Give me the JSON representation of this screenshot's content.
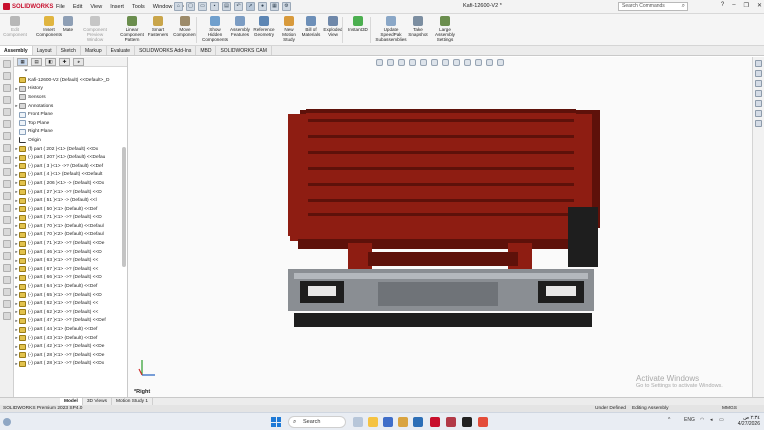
{
  "app": {
    "brand": "SOLIDWORKS",
    "document_title": "Kafi-12600-V2 *"
  },
  "menus": [
    "File",
    "Edit",
    "View",
    "Insert",
    "Tools",
    "Window"
  ],
  "search": {
    "placeholder": "Search Commands"
  },
  "ribbon": [
    {
      "label": "Edit Component",
      "enabled": false,
      "color": "#b7b7b7"
    },
    {
      "label": "Insert Components",
      "enabled": true,
      "color": "#e0b540"
    },
    {
      "label": "Mate",
      "enabled": true,
      "color": "#8e9fb5"
    },
    {
      "label": "Component Preview Window",
      "enabled": false,
      "color": "#c6c6c6"
    },
    {
      "label": "Linear Component Pattern",
      "enabled": true,
      "color": "#6b8e4e"
    },
    {
      "label": "Smart Fasteners",
      "enabled": true,
      "color": "#c9a54a"
    },
    {
      "label": "Move Component",
      "enabled": true,
      "color": "#9d8b6a"
    },
    {
      "label": "Show Hidden Components",
      "enabled": true,
      "color": "#6f9fcd"
    },
    {
      "label": "Assembly Features",
      "enabled": true,
      "color": "#7b9cc3"
    },
    {
      "label": "Reference Geometry",
      "enabled": true,
      "color": "#5d86b4"
    },
    {
      "label": "New Motion Study",
      "enabled": true,
      "color": "#d89a3c"
    },
    {
      "label": "Bill of Materials",
      "enabled": true,
      "color": "#6d8fb8"
    },
    {
      "label": "Exploded View",
      "enabled": true,
      "color": "#6f88aa"
    },
    {
      "label": "Instant3D",
      "enabled": true,
      "color": "#4caf50"
    },
    {
      "label": "Update SpeedPak Subassemblies",
      "enabled": true,
      "color": "#8aa7c7"
    },
    {
      "label": "Take Snapshot",
      "enabled": true,
      "color": "#7c8ea1"
    },
    {
      "label": "Large Assembly Settings",
      "enabled": true,
      "color": "#6b8e4e"
    }
  ],
  "tabs": [
    "Assembly",
    "Layout",
    "Sketch",
    "Markup",
    "Evaluate",
    "SOLIDWORKS Add-Ins",
    "MBD",
    "SOLIDWORKS CAM"
  ],
  "active_tab": "Assembly",
  "tree": {
    "root": "Kafi-12600-V2 (Default) <<Default>_D",
    "items": [
      {
        "label": "History",
        "icon": "folder",
        "expandable": true
      },
      {
        "label": "Sensors",
        "icon": "folder",
        "expandable": false
      },
      {
        "label": "Annotations",
        "icon": "folder",
        "expandable": true
      },
      {
        "label": "Front Plane",
        "icon": "plane",
        "expandable": false
      },
      {
        "label": "Top Plane",
        "icon": "plane",
        "expandable": false
      },
      {
        "label": "Right Plane",
        "icon": "plane",
        "expandable": false
      },
      {
        "label": "Origin",
        "icon": "origin",
        "expandable": false
      },
      {
        "label": "(f) part ( 202 )<1> (Default) <<Dx",
        "icon": "part",
        "expandable": true
      },
      {
        "label": "(-) part ( 207 )<1> (Default) <<Defau",
        "icon": "part",
        "expandable": true
      },
      {
        "label": "(-) part ( 3 )<1> ->? (Default) <<Def",
        "icon": "part",
        "expandable": true
      },
      {
        "label": "(-) part ( 4 )<1> (Default) <<Default",
        "icon": "part",
        "expandable": true
      },
      {
        "label": "(-) part ( 206 )<1> -> (Default) <<Dx",
        "icon": "part",
        "expandable": true
      },
      {
        "label": "(-) part ( 27 )<1> ->? (Default) <<D",
        "icon": "part",
        "expandable": true
      },
      {
        "label": "(-) part ( 51 )<1> -> (Default) <<l",
        "icon": "part",
        "expandable": true
      },
      {
        "label": "(-) part ( 50 )<1> (Default) <<Def",
        "icon": "part",
        "expandable": true
      },
      {
        "label": "(-) part ( 71 )<1> ->? (Default) <<D",
        "icon": "part",
        "expandable": true
      },
      {
        "label": "(-) part ( 70 )<1> (Default) <<Defaul",
        "icon": "part",
        "expandable": true
      },
      {
        "label": "(-) part ( 70 )<2> (Default) <<Defaul",
        "icon": "part",
        "expandable": true
      },
      {
        "label": "(-) part ( 71 )<2> ->? (Default) <<De",
        "icon": "part",
        "expandable": true
      },
      {
        "label": "(-) part ( 46 )<1> ->? (Default) <<D",
        "icon": "part",
        "expandable": true
      },
      {
        "label": "(-) part ( 63 )<1> ->? (Default) <<",
        "icon": "part",
        "expandable": true
      },
      {
        "label": "(-) part ( 67 )<1> ->? (Default) <<",
        "icon": "part",
        "expandable": true
      },
      {
        "label": "(-) part ( 66 )<1> ->? (Default) <<D",
        "icon": "part",
        "expandable": true
      },
      {
        "label": "(-) part ( 64 )<1> (Default) <<Def",
        "icon": "part",
        "expandable": true
      },
      {
        "label": "(-) part ( 65 )<1> ->? (Default) <<D",
        "icon": "part",
        "expandable": true
      },
      {
        "label": "(-) part ( 62 )<1> ->? (Default) <<",
        "icon": "part",
        "expandable": true
      },
      {
        "label": "(-) part ( 62 )<2> ->? (Default) <<",
        "icon": "part",
        "expandable": true
      },
      {
        "label": "(-) part ( 47 )<1> ->? (Default) <<Def",
        "icon": "part",
        "expandable": true
      },
      {
        "label": "(-) part ( 44 )<1> (Default) <<Def",
        "icon": "part",
        "expandable": true
      },
      {
        "label": "(-) part ( 43 )<1> (Default) <<Def",
        "icon": "part",
        "expandable": true
      },
      {
        "label": "(-) part ( 42 )<1> ->? (Default) <<De",
        "icon": "part",
        "expandable": true
      },
      {
        "label": "(-) part ( 28 )<1> ->? (Default) <<De",
        "icon": "part",
        "expandable": true
      },
      {
        "label": "(-) part ( 28 )<1> ->? (Default) <<Dx",
        "icon": "part",
        "expandable": true
      }
    ]
  },
  "graphics": {
    "view_label": "*Right",
    "watermark_title": "Activate Windows",
    "watermark_sub": "Go to Settings to activate Windows.",
    "model_colors": {
      "red": "#8e1d12",
      "red_dark": "#5e110a",
      "steel": "#8a8e93",
      "black": "#1e1e1e"
    }
  },
  "model_tabs": [
    "Model",
    "3D Views",
    "Motion Study 1"
  ],
  "active_model_tab": "Model",
  "status": {
    "left": "SOLIDWORKS Premium 2023 SP4.0",
    "state": "Under Defined",
    "mode": "Editing Assembly",
    "units": "MMGS"
  },
  "taskbar": {
    "search_label": "Search",
    "lang": "ENG",
    "time": "٢:٣٤ ص",
    "date": "4/27/2026"
  }
}
